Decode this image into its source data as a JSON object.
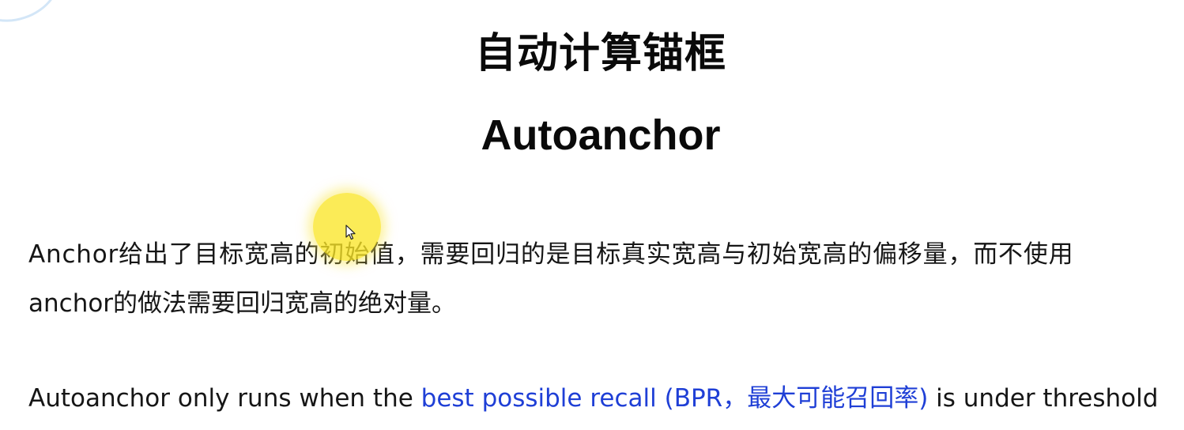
{
  "heading": {
    "title_cn": "自动计算锚框",
    "title_en": "Autoanchor"
  },
  "paragraph": {
    "line1": "Anchor给出了目标宽高的初始值，需要回归的是目标真实宽高与初始宽高的偏移量，而不使用",
    "line2": "anchor的做法需要回归宽高的绝对量。"
  },
  "paragraph_en": {
    "prefix": "Autoanchor only runs when the ",
    "link_text": "best possible recall (BPR，最大可能召回率)",
    "suffix": " is under threshold"
  },
  "colors": {
    "link": "#1f3fd6",
    "cursor_highlight": "#fae628",
    "text": "#161616"
  },
  "icons": {
    "cursor": "mouse-pointer-icon"
  }
}
